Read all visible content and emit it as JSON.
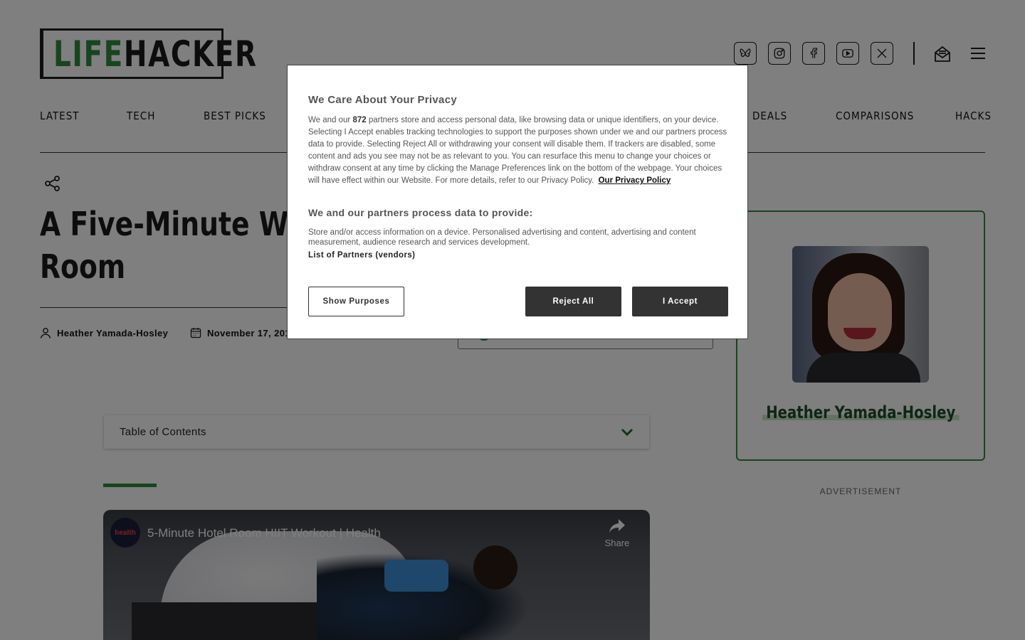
{
  "header": {
    "logo_part1": "LIFE",
    "logo_part2": "HACKER",
    "social_icons": [
      "bluesky-icon",
      "instagram-icon",
      "facebook-icon",
      "youtube-icon",
      "x-icon"
    ],
    "nav": [
      "LATEST",
      "TECH",
      "BEST PICKS",
      "DEALS",
      "COMPARISONS",
      "HACKS"
    ]
  },
  "article": {
    "title_line1": "A Five-Minute Wor",
    "title_line2": "Room",
    "author": "Heather Yamada-Hosley",
    "date": "November 17, 2016",
    "toc_label": "Table of Contents"
  },
  "video": {
    "channel": "health",
    "title": "5-Minute Hotel Room HIIT Workout | Health",
    "share_label": "Share"
  },
  "sidebar": {
    "author_name": "Heather Yamada-Hosley",
    "ad_label": "ADVERTISEMENT"
  },
  "consent": {
    "title": "We Care About Your Privacy",
    "body_intro": "We and our ",
    "partner_count": "872",
    "body_rest": " partners store and access personal data, like browsing data or unique identifiers, on your device. Selecting I Accept enables tracking technologies to support the purposes shown under we and our partners process data to provide. Selecting Reject All or withdrawing your consent will disable them. If trackers are disabled, some content and ads you see may not be as relevant to you. You can resurface this menu to change your choices or withdraw consent at any time by clicking the Manage Preferences link on the bottom of the webpage. Your choices will have effect within our Website. For more details, refer to our Privacy Policy.",
    "privacy_link": "Our Privacy Policy",
    "subtitle": "We and our partners process data to provide:",
    "purposes": "Store and/or access information on a device. Personalised advertising and content, advertising and content measurement, audience research and services development.",
    "partners_link": "List of Partners (vendors)",
    "btn_show": "Show Purposes",
    "btn_reject": "Reject All",
    "btn_accept": "I Accept"
  },
  "colors": {
    "brand_green": "#2e8b3f",
    "overlay": "rgba(0,0,0,0.5)"
  }
}
